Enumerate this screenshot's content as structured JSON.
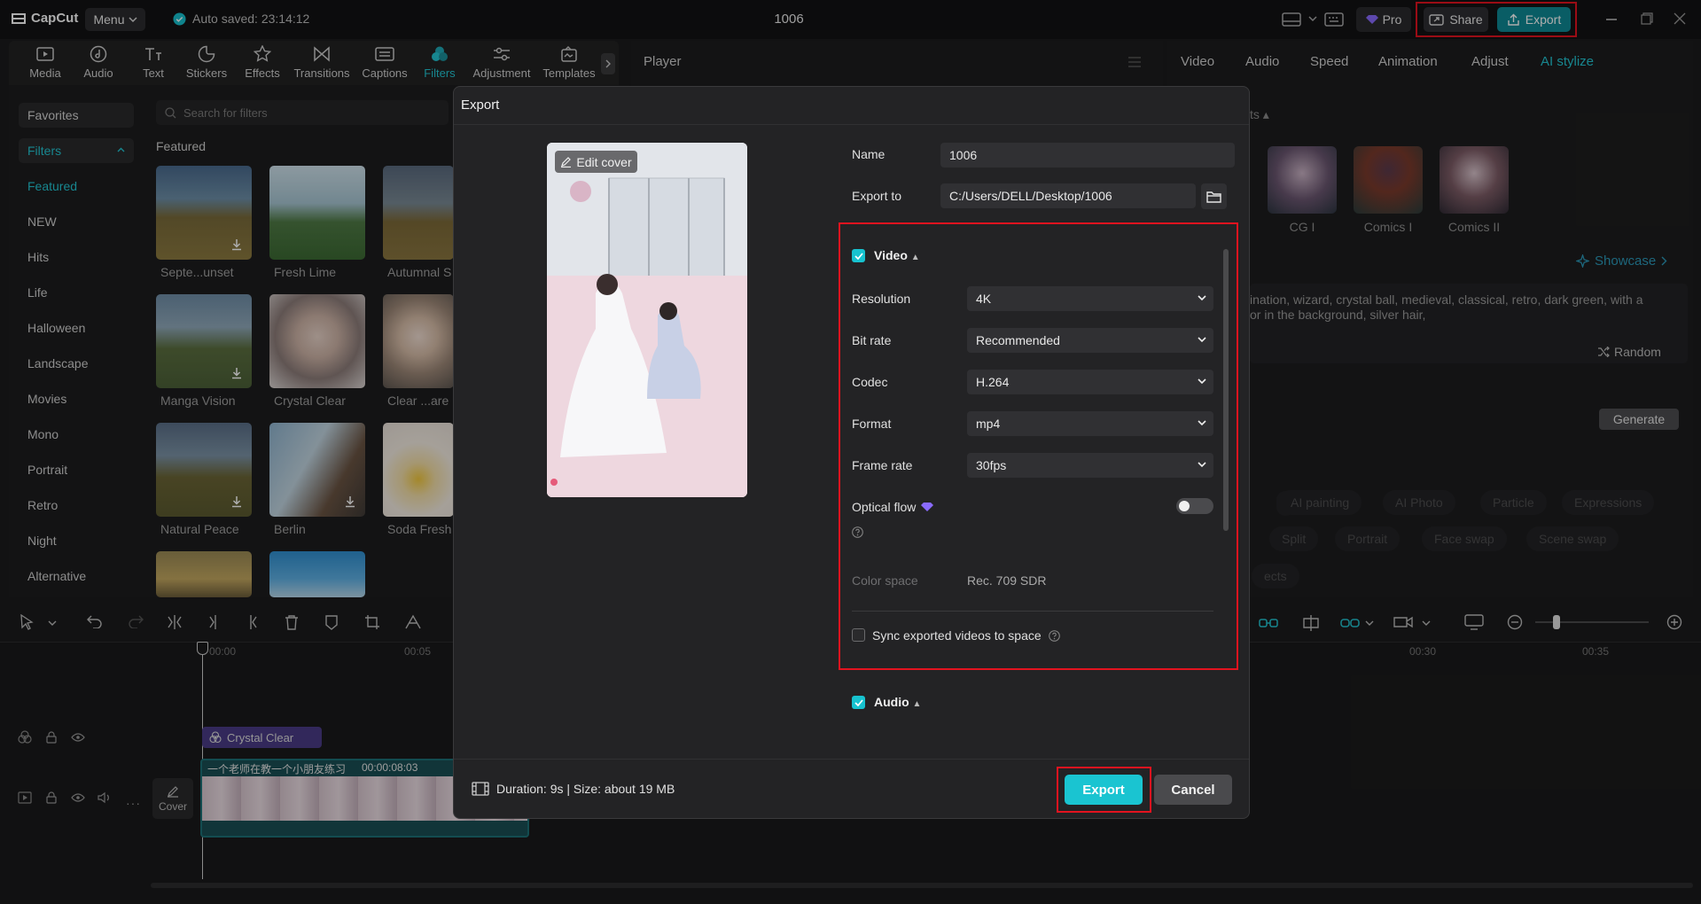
{
  "topbar": {
    "app_name": "CapCut",
    "menu_label": "Menu",
    "autosave": "Auto saved: 23:14:12",
    "project_title": "1006",
    "pro_label": "Pro",
    "share_label": "Share",
    "export_label": "Export"
  },
  "tool_tabs": [
    "Media",
    "Audio",
    "Text",
    "Stickers",
    "Effects",
    "Transitions",
    "Captions",
    "Filters",
    "Adjustment",
    "Templates"
  ],
  "categories": {
    "favorites": "Favorites",
    "filters": "Filters",
    "items": [
      "Featured",
      "NEW",
      "Hits",
      "Life",
      "Halloween",
      "Landscape",
      "Movies",
      "Mono",
      "Portrait",
      "Retro",
      "Night",
      "Alternative"
    ]
  },
  "filters": {
    "search_placeholder": "Search for filters",
    "section": "Featured",
    "items": [
      "Septe...unset",
      "Fresh Lime",
      "Autumnal S",
      "Manga Vision",
      "Crystal Clear",
      "Clear ...are",
      "Natural Peace",
      "Berlin",
      "Soda Fresh"
    ]
  },
  "player": {
    "title": "Player"
  },
  "right_panel": {
    "tabs": [
      "Video",
      "Audio",
      "Speed",
      "Animation",
      "Adjust",
      "AI stylize"
    ],
    "section_partial": "ts",
    "styles": [
      "CG I",
      "Comics I",
      "Comics II"
    ],
    "showcase": "Showcase",
    "prompt_line1": "ination, wizard, crystal ball, medieval, classical, retro, dark green, with a",
    "prompt_line2": "or in the background, silver hair,",
    "random": "Random",
    "generate": "Generate",
    "chips_row1": [
      "AI painting",
      "AI Photo",
      "Particle",
      "Expressions"
    ],
    "chips_row2": [
      "Split",
      "Portrait",
      "Face swap",
      "Scene swap"
    ],
    "chips_row3": [
      "ects"
    ]
  },
  "timeline": {
    "time_marks": [
      "00:00",
      "00:05",
      "00:30",
      "00:35"
    ],
    "filter_clip": "Crystal Clear",
    "video_clip_title": "一个老师在教一个小朋友练习",
    "video_clip_duration": "00:00:08:03",
    "cover_label": "Cover"
  },
  "dialog": {
    "title": "Export",
    "edit_cover": "Edit cover",
    "name_label": "Name",
    "name_value": "1006",
    "export_to_label": "Export to",
    "export_to_value": "C:/Users/DELL/Desktop/1006",
    "video_section": "Video",
    "resolution_label": "Resolution",
    "resolution_value": "4K",
    "bitrate_label": "Bit rate",
    "bitrate_value": "Recommended",
    "codec_label": "Codec",
    "codec_value": "H.264",
    "format_label": "Format",
    "format_value": "mp4",
    "framerate_label": "Frame rate",
    "framerate_value": "30fps",
    "optical_flow_label": "Optical flow",
    "color_space_label": "Color space",
    "color_space_value": "Rec. 709 SDR",
    "sync_label": "Sync exported videos to space",
    "audio_section": "Audio",
    "footer_info": "Duration: 9s | Size: about 19 MB",
    "export_button": "Export",
    "cancel_button": "Cancel"
  },
  "colors": {
    "accent": "#1ac4d1",
    "highlight_box": "#e3131f",
    "background": "#1b1b1c"
  }
}
